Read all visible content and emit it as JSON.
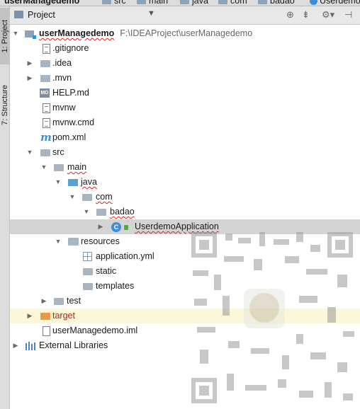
{
  "breadcrumbs": [
    "userManagedemo",
    "src",
    "main",
    "java",
    "com",
    "badao",
    "Userdemo"
  ],
  "tool_window_tabs": {
    "project": "1: Project",
    "structure": "7: Structure"
  },
  "header": {
    "title": "Project",
    "dropdown_icon": "chevron-down-icon",
    "tools": [
      "target-icon",
      "collapse-all-icon",
      "settings-icon",
      "hide-icon"
    ]
  },
  "tree": {
    "root": {
      "name": "userManagedemo",
      "path": "F:\\IDEAProject\\userManagedemo"
    },
    "gitignore": ".gitignore",
    "idea": ".idea",
    "mvn": ".mvn",
    "help": "HELP.md",
    "mvnw": "mvnw",
    "mvnw_cmd": "mvnw.cmd",
    "pom": "pom.xml",
    "src": "src",
    "main": "main",
    "java": "java",
    "com": "com",
    "badao": "badao",
    "app_class": "UserdemoApplication",
    "resources": "resources",
    "app_yml": "application.yml",
    "static": "static",
    "templates": "templates",
    "test": "test",
    "target": "target",
    "iml": "userManagedemo.iml",
    "ext_libs": "External Libraries"
  },
  "colors": {
    "selection": "#d4d4d4",
    "target_highlight": "#fbf7d8",
    "accent": "#3b8ed6"
  }
}
